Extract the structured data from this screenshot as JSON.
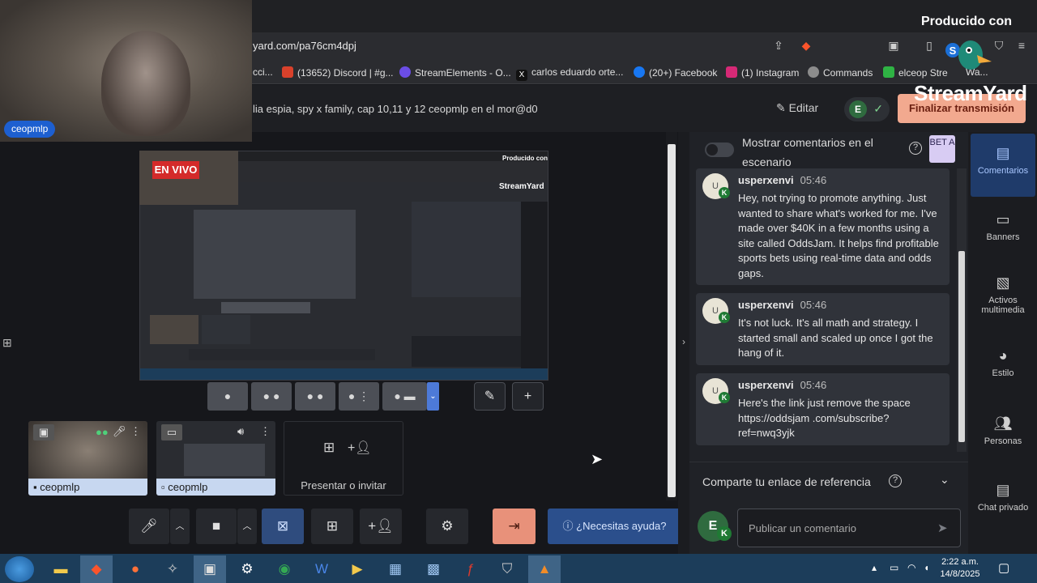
{
  "browser": {
    "url": "yard.com/pa76cm4dpj",
    "bookmarks": [
      {
        "label": "cci...",
        "color": "#5a5a5a"
      },
      {
        "label": "(13652) Discord | #g...",
        "color": "#d9412b"
      },
      {
        "label": "StreamElements - O...",
        "color": "#6b4de6"
      },
      {
        "label": "carlos eduardo orte...",
        "color": "#111111"
      },
      {
        "label": "(20+) Facebook",
        "color": "#1877f2"
      },
      {
        "label": "(1) Instagram",
        "color": "#d62976"
      },
      {
        "label": "Commands",
        "color": "#8c8c8c"
      },
      {
        "label": "elceop Stre",
        "color": "#2fb344"
      },
      {
        "label": "Wa...",
        "color": "#5a5a5a"
      }
    ]
  },
  "watermark": {
    "produced": "Producido con",
    "brand": "StreamYard"
  },
  "header": {
    "stream_title": "lia espia, spy x family, cap 10,11 y 12 ceopmlp en el mor@d0",
    "edit_label": "Editar",
    "avatar_letter": "E",
    "end_label": "Finalizar transmisión"
  },
  "webcam": {
    "name": "ceopmlp"
  },
  "stage": {
    "live_badge": "EN VIVO",
    "mini_produced": "Producido con",
    "mini_brand": "StreamYard"
  },
  "tiles": [
    {
      "name": "ceopmlp",
      "icon": "person-icon"
    },
    {
      "name": "ceopmlp",
      "icon": "screen-icon"
    }
  ],
  "invite_label": "Presentar o invitar",
  "controls": {
    "help_label": "¿Necesitas ayuda?"
  },
  "panel": {
    "show_on_stage": "Mostrar comentarios en el escenario",
    "beta": "BET A",
    "comments": [
      {
        "avatar": "U",
        "user": "usperxenvi",
        "time": "05:46",
        "text": "Hey, not trying to promote anything. Just wanted to share what's worked for me. I've made over $40K in a few months using a site called OddsJam. It helps find profitable sports bets using real-time data and odds gaps."
      },
      {
        "avatar": "U",
        "user": "usperxenvi",
        "time": "05:46",
        "text": "It's not luck. It's all math and strategy. I started small and scaled up once I got the hang of it."
      },
      {
        "avatar": "U",
        "user": "usperxenvi",
        "time": "05:46",
        "text": "Here's the link just remove the space https://oddsjam .com/subscribe?ref=nwq3yjk"
      }
    ],
    "referral_label": "Comparte tu enlace de referencia",
    "my_avatar": "E",
    "comment_placeholder": "Publicar un comentario"
  },
  "rail": [
    {
      "label": "Comentarios",
      "icon": "comment-icon",
      "active": true
    },
    {
      "label": "Banners",
      "icon": "banner-icon",
      "active": false
    },
    {
      "label": "Activos multimedia",
      "icon": "media-icon",
      "active": false
    },
    {
      "label": "Estilo",
      "icon": "palette-icon",
      "active": false
    },
    {
      "label": "Personas",
      "icon": "people-icon",
      "active": false
    },
    {
      "label": "Chat privado",
      "icon": "chat-icon",
      "active": false
    }
  ],
  "taskbar": {
    "time": "2:22 a.m.",
    "date": "14/8/2025"
  }
}
